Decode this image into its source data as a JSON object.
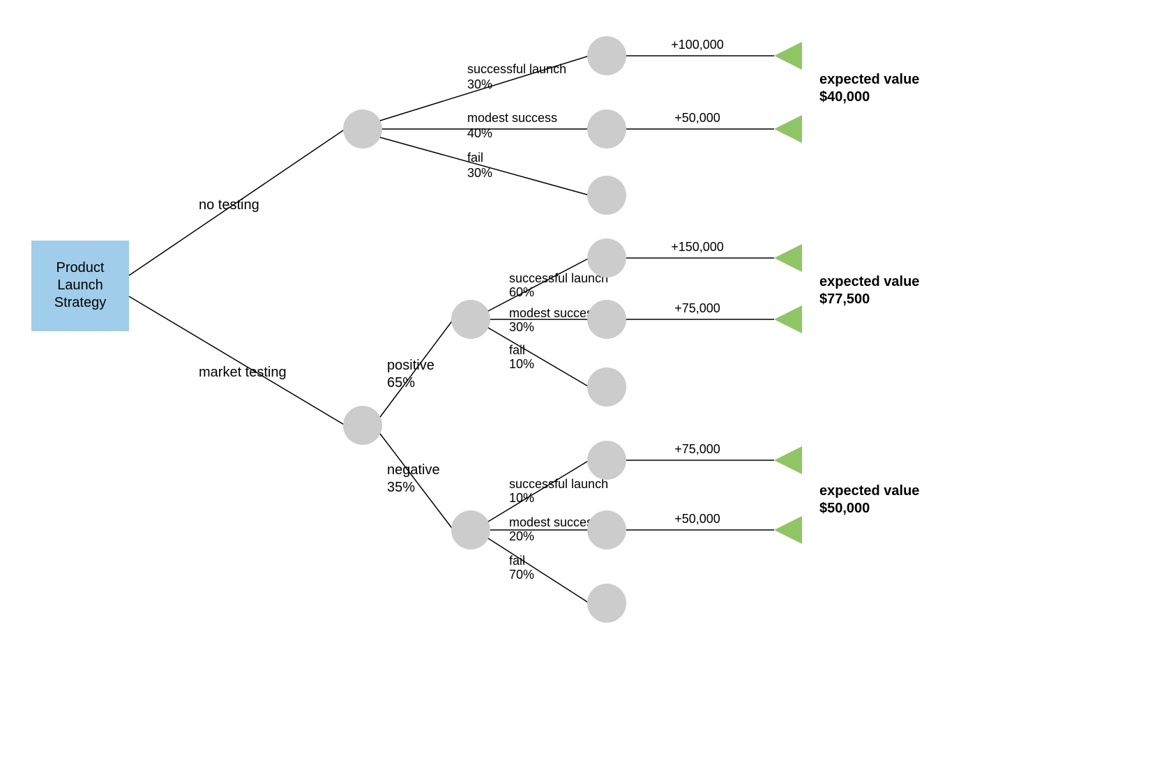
{
  "root": {
    "line1": "Product",
    "line2": "Launch",
    "line3": "Strategy"
  },
  "branches": {
    "no_testing": {
      "label": "no testing",
      "outcomes": {
        "success": {
          "label": "successful launch",
          "prob": "30%",
          "value": "+100,000"
        },
        "modest": {
          "label": "modest success",
          "prob": "40%",
          "value": "+50,000"
        },
        "fail": {
          "label": "fail",
          "prob": "30%"
        }
      },
      "ev": {
        "label": "expected value",
        "amount": "$40,000"
      }
    },
    "market_testing": {
      "label": "market testing",
      "sub": {
        "positive": {
          "label": "positive",
          "prob": "65%",
          "outcomes": {
            "success": {
              "label": "successful launch",
              "prob": "60%",
              "value": "+150,000"
            },
            "modest": {
              "label": "modest success",
              "prob": "30%",
              "value": "+75,000"
            },
            "fail": {
              "label": "fail",
              "prob": "10%"
            }
          },
          "ev": {
            "label": "expected value",
            "amount": "$77,500"
          }
        },
        "negative": {
          "label": "negative",
          "prob": "35%",
          "outcomes": {
            "success": {
              "label": "successful launch",
              "prob": "10%",
              "value": "+75,000"
            },
            "modest": {
              "label": "modest success",
              "prob": "20%",
              "value": "+50,000"
            },
            "fail": {
              "label": "fail",
              "prob": "70%"
            }
          },
          "ev": {
            "label": "expected value",
            "amount": "$50,000"
          }
        }
      }
    }
  }
}
